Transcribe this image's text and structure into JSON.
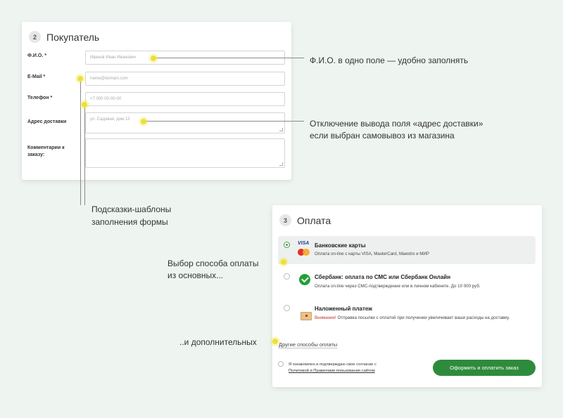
{
  "buyer": {
    "step": "2",
    "title": "Покупатель",
    "fields": [
      {
        "label": "Ф.И.О. *",
        "placeholder": "Иванов Иван Иванович"
      },
      {
        "label": "E-Mail *",
        "placeholder": "name@domain.com"
      },
      {
        "label": "Телефон *",
        "placeholder": "+7 000 00-00-00"
      },
      {
        "label": "Адрес доставки",
        "placeholder": "ул. Садовая, дом 12"
      },
      {
        "label": "Комментарии к заказу:",
        "placeholder": ""
      }
    ]
  },
  "payment": {
    "step": "3",
    "title": "Оплата",
    "options": [
      {
        "title": "Банковские карты",
        "desc": "Оплата on-line с карты VISA, MasterCard, Maestro и МИР",
        "icon": "card-icon",
        "selected": true
      },
      {
        "title": "Сбербанк: оплата по СМС или Сбербанк Онлайн",
        "desc": "Оплата on-line через СМС-подтверждение или в личном кабинете. До 10 000 руб.",
        "icon": "sberbank-icon",
        "selected": false
      },
      {
        "title": "Наложенный платеж",
        "warn": "Внимание!",
        "desc": " Отправка посылки с оплатой при получении увеличивает ваши расходы на доставку.",
        "icon": "parcel-icon",
        "selected": false
      }
    ],
    "other_link": "Другие способы оплаты",
    "agree_text": "Я ознакомлен и подтверждаю свое согласие с",
    "agree_link": "Политикой и Правилами пользования сайтом",
    "submit": "Оформить и оплатить заказ",
    "visa_text": "VISA"
  },
  "notes": {
    "fio": "Ф.И.О. в одно поле — удобно заполнять",
    "address_line1": "Отключение вывода поля «адрес доставки»",
    "address_line2": "если выбран самовывоз из магазина",
    "hints_line1": "Подсказки-шаблоны",
    "hints_line2": "заполнения формы",
    "payment_line1": "Выбор способа оплаты",
    "payment_line2": "из основных...",
    "additional": "..и дополнительных"
  },
  "colors": {
    "background": "#eef5f1",
    "accent_green": "#2f8b3c",
    "marker_yellow": "#ece03a",
    "warning_red": "#c0392b"
  }
}
